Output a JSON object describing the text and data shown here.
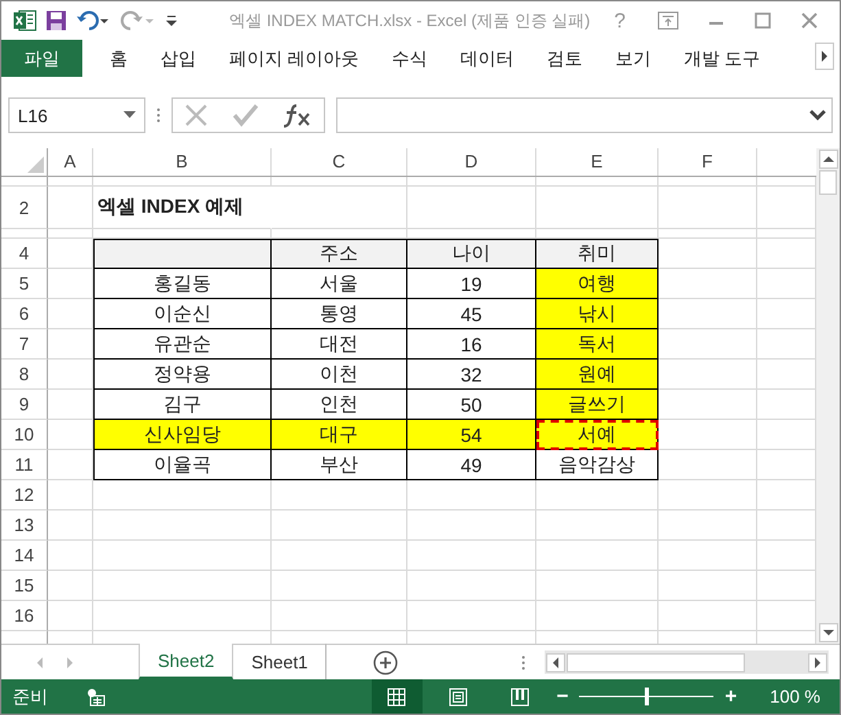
{
  "window": {
    "title": "엑셀 INDEX MATCH.xlsx - Excel (제품 인증 실패)",
    "help": "?"
  },
  "ribbon_tabs": [
    {
      "label": "파일",
      "kind": "file"
    },
    {
      "label": "홈",
      "kind": "tab"
    },
    {
      "label": "삽입",
      "kind": "tab"
    },
    {
      "label": "페이지 레이아웃",
      "kind": "tab"
    },
    {
      "label": "수식",
      "kind": "tab"
    },
    {
      "label": "데이터",
      "kind": "tab"
    },
    {
      "label": "검토",
      "kind": "tab"
    },
    {
      "label": "보기",
      "kind": "tab"
    },
    {
      "label": "개발 도구",
      "kind": "tab"
    }
  ],
  "formula_bar": {
    "name_box": "L16"
  },
  "columns": [
    "A",
    "B",
    "C",
    "D",
    "E",
    "F"
  ],
  "grid_rows": [
    {
      "kind": "thin"
    },
    {
      "kind": "title",
      "number": "2"
    },
    {
      "kind": "thin"
    },
    {
      "kind": "header",
      "number": "4"
    },
    {
      "kind": "data",
      "number": "5"
    },
    {
      "kind": "data",
      "number": "6"
    },
    {
      "kind": "data",
      "number": "7"
    },
    {
      "kind": "data",
      "number": "8"
    },
    {
      "kind": "data",
      "number": "9"
    },
    {
      "kind": "data",
      "number": "10"
    },
    {
      "kind": "data",
      "number": "11"
    },
    {
      "kind": "empty",
      "number": "12"
    },
    {
      "kind": "empty",
      "number": "13"
    },
    {
      "kind": "empty",
      "number": "14"
    },
    {
      "kind": "empty",
      "number": "15"
    },
    {
      "kind": "empty",
      "number": "16"
    },
    {
      "kind": "cut"
    }
  ],
  "sheet_title": "엑셀 INDEX 예제",
  "table": {
    "headers": [
      "주소",
      "나이",
      "취미"
    ],
    "rows": [
      {
        "name": "홍길동",
        "address": "서울",
        "age": "19",
        "hobby": "여행",
        "highlighted": false,
        "hobby_highlighted": true,
        "marquee": false
      },
      {
        "name": "이순신",
        "address": "통영",
        "age": "45",
        "hobby": "낚시",
        "highlighted": false,
        "hobby_highlighted": true,
        "marquee": false
      },
      {
        "name": "유관순",
        "address": "대전",
        "age": "16",
        "hobby": "독서",
        "highlighted": false,
        "hobby_highlighted": true,
        "marquee": false
      },
      {
        "name": "정약용",
        "address": "이천",
        "age": "32",
        "hobby": "원예",
        "highlighted": false,
        "hobby_highlighted": true,
        "marquee": false
      },
      {
        "name": "김구",
        "address": "인천",
        "age": "50",
        "hobby": "글쓰기",
        "highlighted": false,
        "hobby_highlighted": true,
        "marquee": false
      },
      {
        "name": "신사임당",
        "address": "대구",
        "age": "54",
        "hobby": "서예",
        "highlighted": true,
        "hobby_highlighted": true,
        "marquee": true
      },
      {
        "name": "이율곡",
        "address": "부산",
        "age": "49",
        "hobby": "음악감상",
        "highlighted": false,
        "hobby_highlighted": false,
        "marquee": false
      }
    ]
  },
  "sheet_tabs": [
    {
      "label": "Sheet2",
      "selected": true
    },
    {
      "label": "Sheet1",
      "selected": false
    }
  ],
  "status_bar": {
    "status": "준비",
    "views": [
      {
        "kind": "normal",
        "selected": true
      },
      {
        "kind": "page_layout",
        "selected": false
      },
      {
        "kind": "page_break",
        "selected": false
      }
    ],
    "zoom": {
      "level": 0.5,
      "reading": "100 %",
      "zoom_out": "−",
      "zoom_in": "+"
    }
  }
}
